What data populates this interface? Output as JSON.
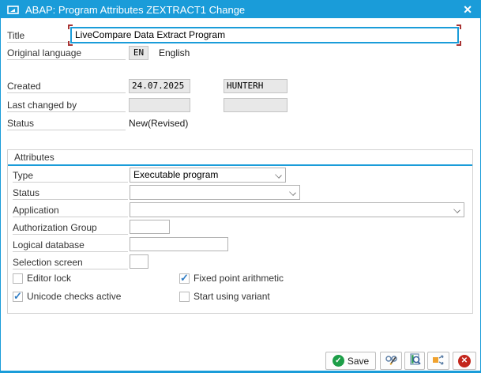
{
  "window": {
    "title": "ABAP: Program Attributes ZEXTRACT1 Change",
    "close_glyph": "✕"
  },
  "general": {
    "title_field": {
      "label": "Title",
      "value": "LiveCompare Data Extract Program"
    },
    "original_language": {
      "label": "Original language",
      "code": "EN",
      "language_name": "English"
    },
    "created": {
      "label": "Created",
      "date": "24.07.2025",
      "user": "HUNTERH"
    },
    "last_changed_by": {
      "label": "Last changed by",
      "date": "",
      "user": ""
    },
    "status": {
      "label": "Status",
      "value": "New(Revised)"
    }
  },
  "attributes": {
    "frame_title": "Attributes",
    "type": {
      "label": "Type",
      "value": "Executable program"
    },
    "status": {
      "label": "Status",
      "value": ""
    },
    "application": {
      "label": "Application",
      "value": ""
    },
    "authorization_group": {
      "label": "Authorization Group",
      "value": ""
    },
    "logical_database": {
      "label": "Logical database",
      "value": ""
    },
    "selection_screen": {
      "label": "Selection screen",
      "value": ""
    },
    "checkboxes": [
      {
        "label": "Editor lock",
        "checked": false
      },
      {
        "label": "Fixed point arithmetic",
        "checked": true
      },
      {
        "label": "Unicode checks active",
        "checked": true
      },
      {
        "label": "Start using variant",
        "checked": false
      }
    ]
  },
  "footer": {
    "save_label": "Save",
    "save_check_glyph": "✓",
    "cancel_glyph": "✕",
    "icons": [
      "display-change-icon",
      "check-icon",
      "where-used-icon",
      "cancel-icon"
    ]
  },
  "colors": {
    "titlebar_blue": "#1a9cd9",
    "focus_corner_red": "#a83434",
    "checkbox_check_blue": "#2f7cc4",
    "save_green": "#1d9e48",
    "cancel_red": "#c3261c",
    "where_used_orange": "#f0a22e",
    "readonly_gray": "#e8e8e8"
  }
}
